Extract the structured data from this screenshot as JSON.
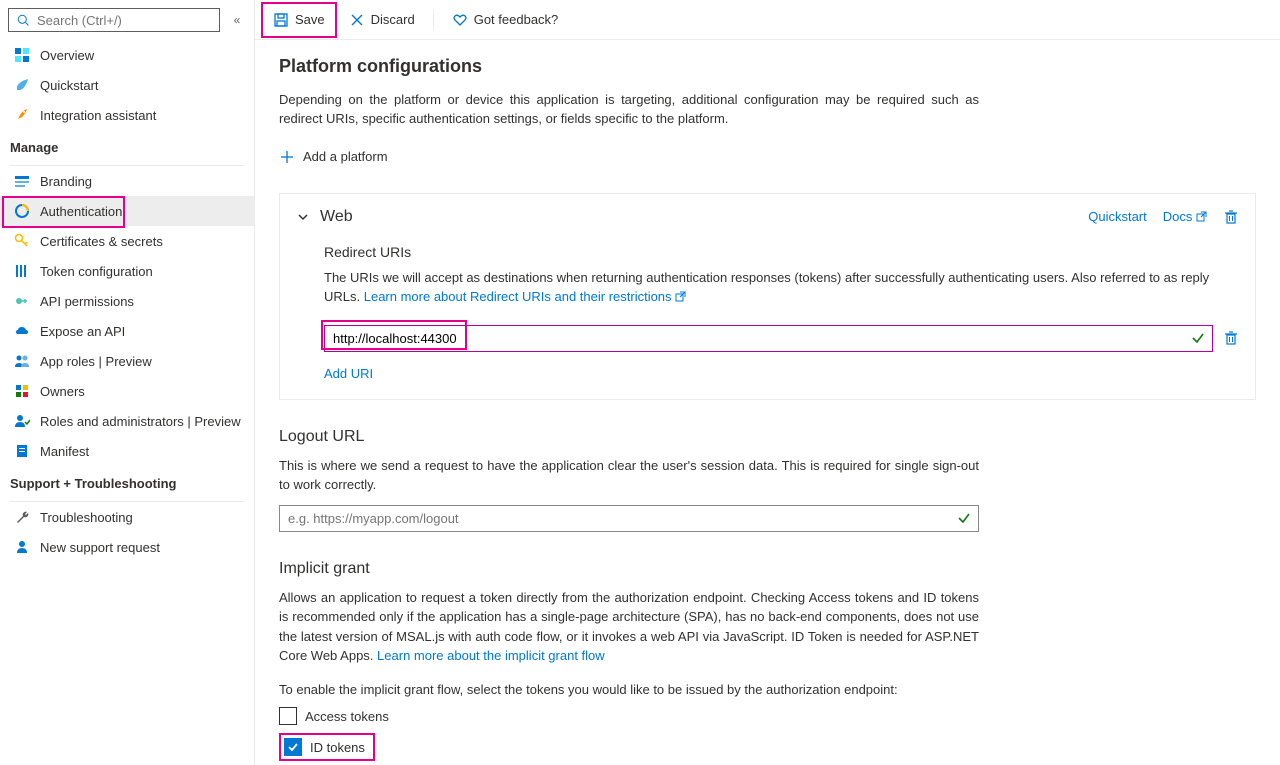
{
  "search": {
    "placeholder": "Search (Ctrl+/)"
  },
  "sidebar": {
    "top": [
      {
        "label": "Overview"
      },
      {
        "label": "Quickstart"
      },
      {
        "label": "Integration assistant"
      }
    ],
    "manage_header": "Manage",
    "manage": [
      {
        "label": "Branding"
      },
      {
        "label": "Authentication"
      },
      {
        "label": "Certificates & secrets"
      },
      {
        "label": "Token configuration"
      },
      {
        "label": "API permissions"
      },
      {
        "label": "Expose an API"
      },
      {
        "label": "App roles | Preview"
      },
      {
        "label": "Owners"
      },
      {
        "label": "Roles and administrators | Preview"
      },
      {
        "label": "Manifest"
      }
    ],
    "support_header": "Support + Troubleshooting",
    "support": [
      {
        "label": "Troubleshooting"
      },
      {
        "label": "New support request"
      }
    ]
  },
  "toolbar": {
    "save": "Save",
    "discard": "Discard",
    "feedback": "Got feedback?"
  },
  "page": {
    "title": "Platform configurations",
    "desc": "Depending on the platform or device this application is targeting, additional configuration may be required such as redirect URIs, specific authentication settings, or fields specific to the platform.",
    "add_platform": "Add a platform"
  },
  "web_card": {
    "title": "Web",
    "quickstart": "Quickstart",
    "docs": "Docs",
    "redirect_title": "Redirect URIs",
    "redirect_desc": "The URIs we will accept as destinations when returning authentication responses (tokens) after successfully authenticating users. Also referred to as reply URLs. ",
    "redirect_link": "Learn more about Redirect URIs and their restrictions",
    "uri_value": "http://localhost:44300",
    "add_uri": "Add URI"
  },
  "logout": {
    "title": "Logout URL",
    "desc": "This is where we send a request to have the application clear the user's session data. This is required for single sign-out to work correctly.",
    "placeholder": "e.g. https://myapp.com/logout"
  },
  "implicit": {
    "title": "Implicit grant",
    "desc": "Allows an application to request a token directly from the authorization endpoint. Checking Access tokens and ID tokens is recommended only if the application has a single-page architecture (SPA), has no back-end components, does not use the latest version of MSAL.js with auth code flow, or it invokes a web API via JavaScript. ID Token is needed for ASP.NET Core Web Apps. ",
    "link": "Learn more about the implicit grant flow",
    "enable_text": "To enable the implicit grant flow, select the tokens you would like to be issued by the authorization endpoint:",
    "access_tokens": "Access tokens",
    "id_tokens": "ID tokens"
  }
}
